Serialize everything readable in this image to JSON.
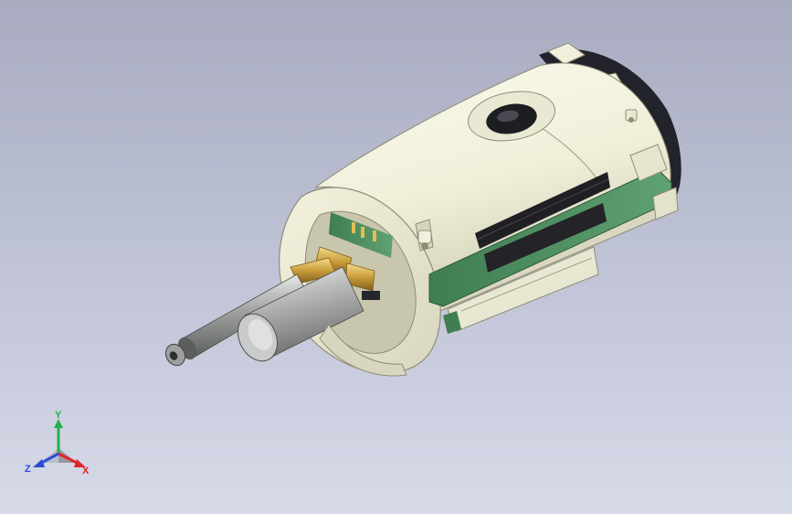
{
  "viewport": {
    "background_top": "#a9acc0",
    "background_bottom": "#d7dae8"
  },
  "model": {
    "body_color": "#f1f0dc",
    "shadow_color": "#cfcdb5",
    "pcb_color": "#4f8f62",
    "shaft_color": "#a9abaa",
    "brass_color": "#c9a341"
  },
  "triad": {
    "y_label": "Y",
    "x_label": "X",
    "z_label": "Z",
    "y_color": "#22b14c",
    "x_color": "#e0242b",
    "z_color": "#2f4bd6"
  }
}
